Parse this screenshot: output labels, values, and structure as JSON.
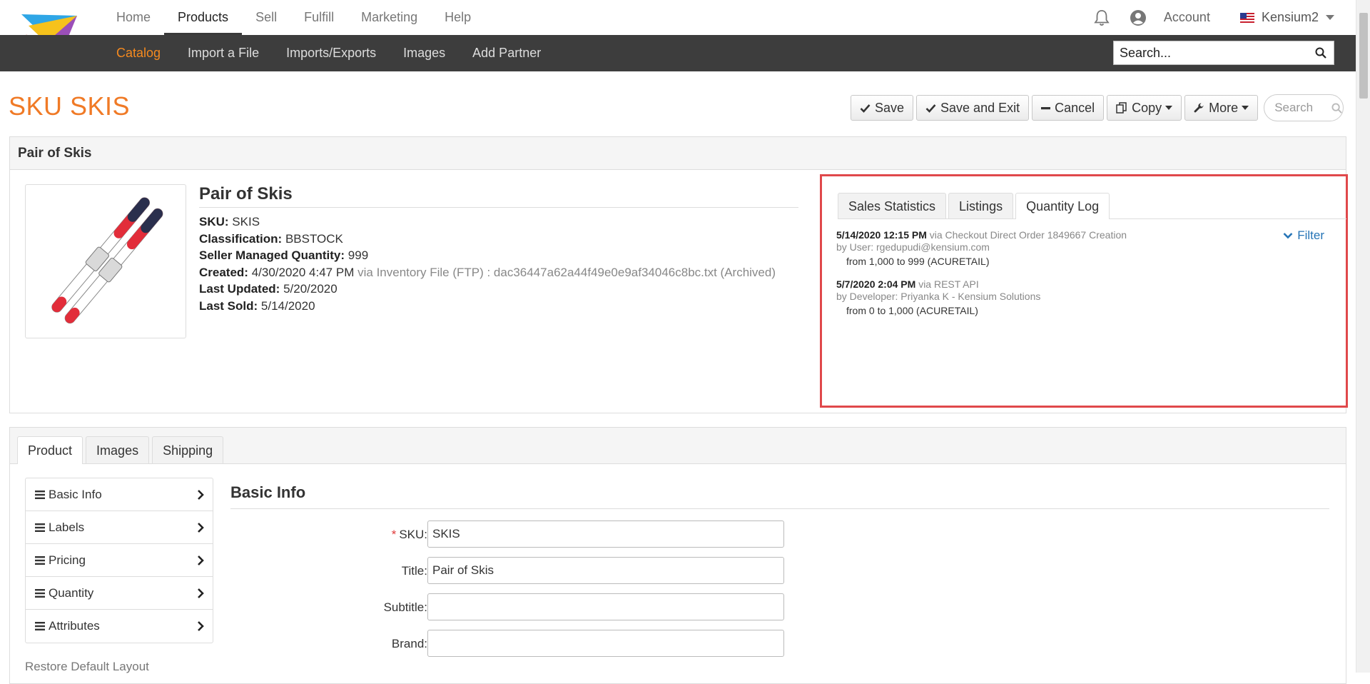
{
  "nav": {
    "main": [
      "Home",
      "Products",
      "Sell",
      "Fulfill",
      "Marketing",
      "Help"
    ],
    "account_label": "Account",
    "company": "Kensium2",
    "sub": [
      "Catalog",
      "Import a File",
      "Imports/Exports",
      "Images",
      "Add Partner"
    ],
    "search_placeholder": "Search..."
  },
  "page": {
    "title": "SKU SKIS",
    "actions": {
      "save": "Save",
      "save_exit": "Save and Exit",
      "cancel": "Cancel",
      "copy": "Copy",
      "more": "More",
      "search_placeholder": "Search"
    }
  },
  "summary": {
    "header": "Pair of Skis",
    "product_name": "Pair of Skis",
    "sku_label": "SKU:",
    "sku": "SKIS",
    "classification_label": "Classification:",
    "classification": "BBSTOCK",
    "smq_label": "Seller Managed Quantity:",
    "smq": "999",
    "created_label": "Created:",
    "created": "4/30/2020 4:47 PM",
    "created_via": "via Inventory File (FTP) : dac36447a62a44f49e0e9af34046c8bc.txt (Archived)",
    "updated_label": "Last Updated:",
    "updated": "5/20/2020",
    "sold_label": "Last Sold:",
    "sold": "5/14/2020"
  },
  "log": {
    "tabs": [
      "Sales Statistics",
      "Listings",
      "Quantity Log"
    ],
    "active_tab": "Quantity Log",
    "filter_label": "Filter",
    "entries": [
      {
        "when": "5/14/2020 12:15 PM",
        "via": "via Checkout Direct Order 1849667 Creation",
        "by": "by User: rgedupudi@kensium.com",
        "change": "from 1,000 to 999 (ACURETAIL)"
      },
      {
        "when": "5/7/2020 2:04 PM",
        "via": "via REST API",
        "by": "by Developer: Priyanka K - Kensium Solutions",
        "change": "from 0 to 1,000 (ACURETAIL)"
      }
    ]
  },
  "lower": {
    "tabs": [
      "Product",
      "Images",
      "Shipping"
    ],
    "menu": [
      "Basic Info",
      "Labels",
      "Pricing",
      "Quantity",
      "Attributes"
    ],
    "restore_label": "Restore Default Layout",
    "section_title": "Basic Info",
    "fields": {
      "sku_label": "SKU:",
      "sku_value": "SKIS",
      "title_label": "Title:",
      "title_value": "Pair of Skis",
      "subtitle_label": "Subtitle:",
      "subtitle_value": "",
      "brand_label": "Brand:",
      "brand_value": ""
    }
  },
  "colors": {
    "brand_orange": "#f07a26",
    "nav_dark": "#3d3d3d",
    "link_blue": "#2574b6",
    "highlight_red": "#e0484b"
  }
}
